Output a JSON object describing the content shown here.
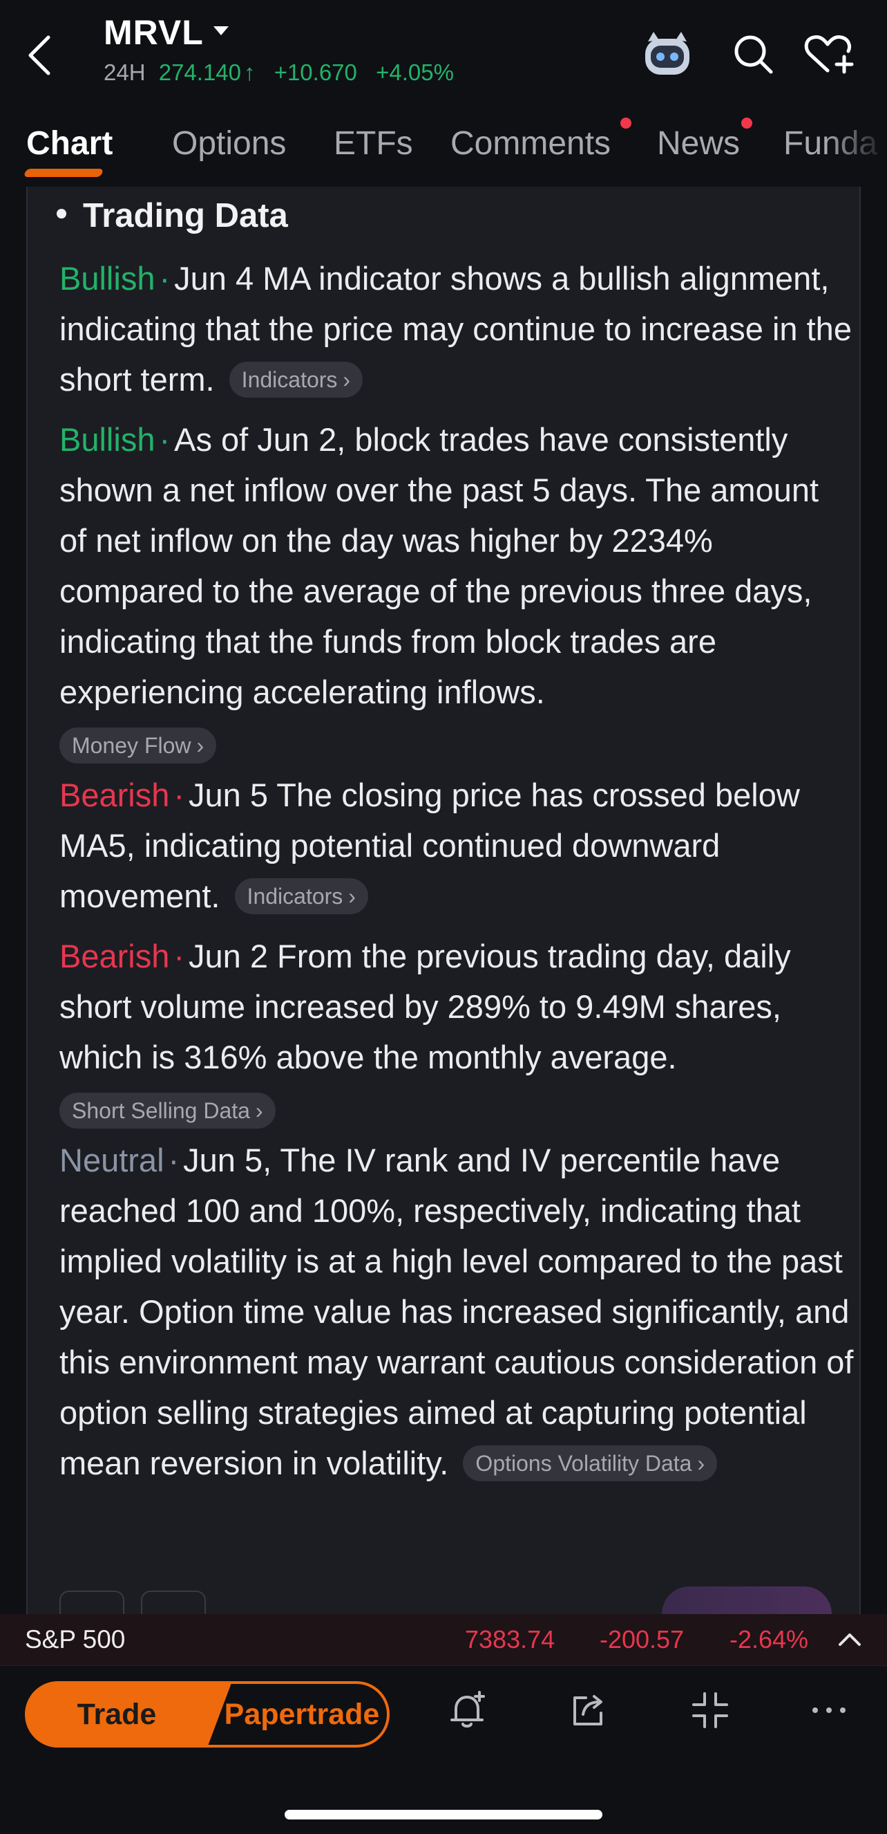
{
  "header": {
    "ticker": "MRVL",
    "session": "24H",
    "price": "274.140",
    "price_arrow": "↑",
    "change": "+10.670",
    "change_pct": "+4.05%"
  },
  "tabs": [
    {
      "label": "Chart",
      "active": true
    },
    {
      "label": "Options"
    },
    {
      "label": "ETFs"
    },
    {
      "label": "Comments",
      "badge": true
    },
    {
      "label": "News",
      "badge": true
    },
    {
      "label": "Funda"
    }
  ],
  "section": {
    "title": "Trading Data"
  },
  "entries": [
    {
      "sentiment": "Bullish",
      "text": "Jun 4 MA indicator shows a bullish alignment, indicating that the price may continue to increase in the short term.",
      "chip": "Indicators"
    },
    {
      "sentiment": "Bullish",
      "text": "As of Jun 2, block trades have consistently shown a net inflow over the past 5 days. The amount of net inflow on the day was higher by 2234% compared to the average of the previous three days, indicating that the funds from block trades are experiencing accelerating inflows.",
      "chip": "Money Flow"
    },
    {
      "sentiment": "Bearish",
      "text": "Jun 5 The closing price has crossed below MA5, indicating potential continued downward movement.",
      "chip": "Indicators"
    },
    {
      "sentiment": "Bearish",
      "text": "Jun 2 From the previous trading day, daily short volume increased by 289% to 9.49M shares, which is 316% above the monthly average.",
      "chip": "Short Selling Data"
    },
    {
      "sentiment": "Neutral",
      "text": "Jun 5, The IV rank and IV percentile have reached 100 and 100%, respectively, indicating that implied volatility is at a high level compared to the past year. Option time value has increased significantly, and this environment may warrant cautious consideration of option selling strategies aimed at capturing potential mean reversion in volatility.",
      "chip": "Options Volatility Data"
    }
  ],
  "separator": "·",
  "chevron": "›",
  "index_bar": {
    "name": "S&P 500",
    "price": "7383.74",
    "change": "-200.57",
    "change_pct": "-2.64%"
  },
  "bottom_bar": {
    "trade_label": "Trade",
    "papertrade_label": "Papertrade",
    "icons": [
      "alert-bell-icon",
      "share-icon",
      "collapse-icon",
      "more-icon"
    ]
  },
  "colors": {
    "bullish": "#22b36a",
    "bearish": "#e8364f",
    "neutral": "#8a94a6",
    "accent": "#ee6a0c"
  }
}
